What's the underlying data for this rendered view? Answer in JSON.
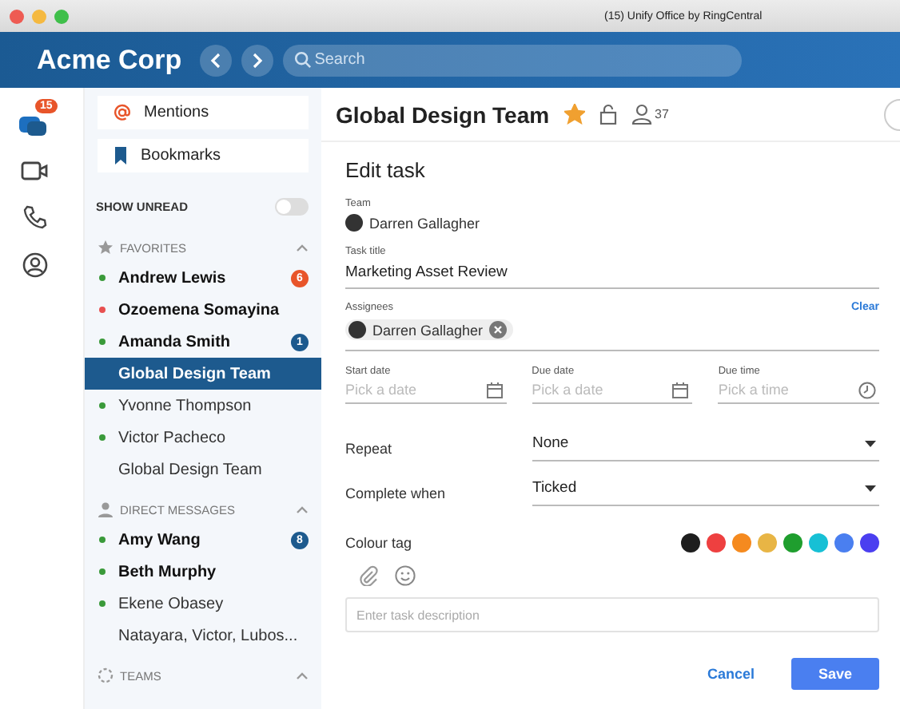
{
  "window": {
    "title": "(15) Unify Office  by RingCentral"
  },
  "header": {
    "brand": "Acme Corp",
    "search": {
      "placeholder": "Search"
    }
  },
  "rail": {
    "messages_badge": "15"
  },
  "sidebar": {
    "quick_links": [
      {
        "kind": "mention",
        "label": "Mentions"
      },
      {
        "kind": "bookmark",
        "label": "Bookmarks"
      }
    ],
    "show_unread": {
      "label": "SHOW UNREAD",
      "on": false
    },
    "sections": [
      {
        "kind": "favorites",
        "title": "FAVORITES",
        "expanded": true,
        "items": [
          {
            "name": "Andrew Lewis",
            "color": "#3a9a3a",
            "unread": true,
            "selected": false,
            "badge": {
              "text": "6",
              "color": "#e8552a"
            }
          },
          {
            "name": "Ozoemena Somayina",
            "color": "#e85050",
            "unread": true,
            "selected": false
          },
          {
            "name": "Amanda Smith",
            "color": "#3a9a3a",
            "unread": true,
            "selected": false,
            "badge": {
              "text": "1",
              "color": "#1d5a8e"
            }
          },
          {
            "name": "Global Design Team",
            "unread": true,
            "selected": true
          },
          {
            "name": "Yvonne Thompson",
            "color": "#3a9a3a",
            "unread": false,
            "selected": false
          },
          {
            "name": "Victor Pacheco",
            "color": "#3a9a3a",
            "unread": false,
            "selected": false
          },
          {
            "name": "Global Design Team",
            "unread": false,
            "selected": false
          }
        ]
      },
      {
        "kind": "direct",
        "title": "DIRECT MESSAGES",
        "expanded": true,
        "items": [
          {
            "name": "Amy Wang",
            "color": "#3a9a3a",
            "unread": true,
            "selected": false,
            "badge": {
              "text": "8",
              "color": "#1d5a8e"
            }
          },
          {
            "name": "Beth Murphy",
            "color": "#3a9a3a",
            "unread": true,
            "selected": false
          },
          {
            "name": "Ekene Obasey",
            "color": "#3a9a3a",
            "unread": false,
            "selected": false
          },
          {
            "name": "Natayara, Victor, Lubos...",
            "unread": false,
            "selected": false
          }
        ]
      },
      {
        "kind": "teams",
        "title": "TEAMS",
        "expanded": true
      }
    ]
  },
  "conversation": {
    "title": "Global Design Team",
    "favorite": true,
    "member_count": "37"
  },
  "task_form": {
    "heading": "Edit task",
    "team": {
      "label": "Team",
      "value": "Darren Gallagher"
    },
    "task_title": {
      "label": "Task title",
      "value": "Marketing Asset Review"
    },
    "assignees": {
      "label": "Assignees",
      "clear": "Clear",
      "chips": [
        "Darren Gallagher"
      ]
    },
    "dates": [
      {
        "kind": "date",
        "label": "Start date",
        "placeholder": "Pick a date"
      },
      {
        "kind": "date",
        "label": "Due date",
        "placeholder": "Pick a date"
      },
      {
        "kind": "time",
        "label": "Due time",
        "placeholder": "Pick a time"
      }
    ],
    "selects": [
      {
        "label": "Repeat",
        "value": "None"
      },
      {
        "label": "Complete when",
        "value": "Ticked"
      }
    ],
    "colour_tag": {
      "label": "Colour tag",
      "colors": [
        {
          "color": "#1e1e1e",
          "selected": false
        },
        {
          "color": "#ee4040",
          "selected": false
        },
        {
          "color": "#f58a1f",
          "selected": false
        },
        {
          "color": "#e8b545",
          "selected": false
        },
        {
          "color": "#1f9e2e",
          "selected": false
        },
        {
          "color": "#17c0d5",
          "selected": false
        },
        {
          "color": "#4a7ff0",
          "selected": false
        },
        {
          "color": "#4b3ff0",
          "selected": false
        }
      ]
    },
    "description": {
      "placeholder": "Enter task description"
    },
    "buttons": [
      {
        "kind": "secondary",
        "label": "Cancel"
      },
      {
        "kind": "primary",
        "label": "Save"
      }
    ]
  }
}
